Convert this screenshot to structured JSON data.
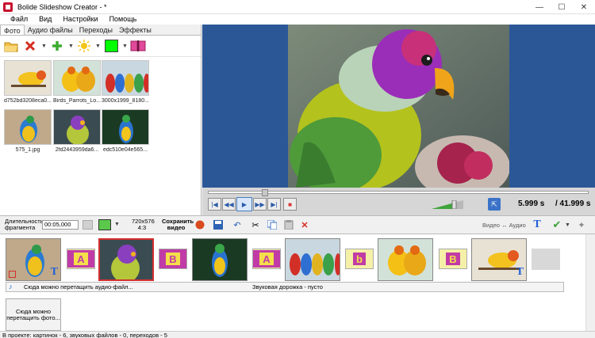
{
  "window": {
    "title": "Bolide Slideshow Creator - *"
  },
  "menu": [
    "Файл",
    "Вид",
    "Настройки",
    "Помощь"
  ],
  "tabs": [
    "Фото",
    "Аудио файлы",
    "Переходы",
    "Эффекты"
  ],
  "thumbnails": [
    {
      "caption": "d752bd3208eca0..."
    },
    {
      "caption": "Birds_Parrots_Lo..."
    },
    {
      "caption": "3000x1999_8180..."
    },
    {
      "caption": "575_1.jpg"
    },
    {
      "caption": "2fd2443959da6..."
    },
    {
      "caption": "edc510e04e565..."
    }
  ],
  "player": {
    "position_fraction": 0.143,
    "current_time": "5.999 s",
    "total_time": "/ 41.999 s"
  },
  "timeline_toolbar": {
    "duration_label_1": "Длительность",
    "duration_label_2": "фрагмента",
    "duration_value": "00:05,000",
    "resolution_1": "720x576",
    "resolution_2": "4:3",
    "save_video_1": "Сохранить",
    "save_video_2": "видео",
    "video_audio": "Видео ↔ Аудио"
  },
  "timeline": {
    "audio_drag_hint": "Сюда можно перетащить аудио-файл...",
    "audio_track_empty": "Звуковая дорожка - пусто",
    "drop_photo_hint": "Сюда можно перетащить фото..."
  },
  "status": "В проекте: картинок - 6, звуковых файлов - 0, переходов - 5",
  "colors": {
    "preview_bg": "#2b5797",
    "accent_green": "#00ff00",
    "selected_border": "#d32f2f"
  }
}
